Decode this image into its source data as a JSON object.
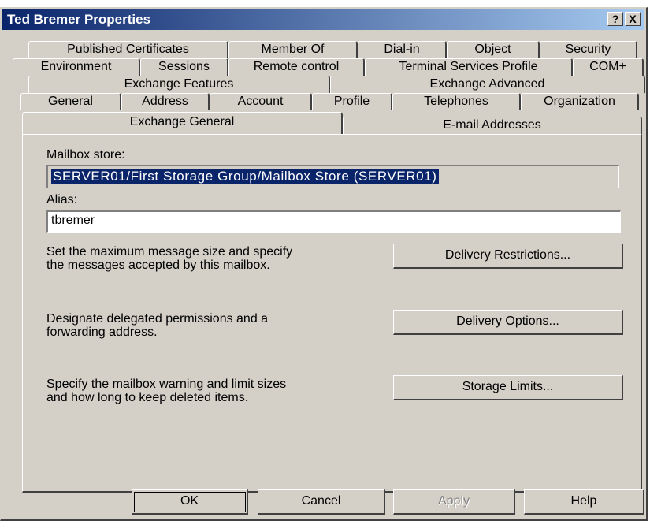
{
  "window": {
    "title": "Ted Bremer Properties",
    "help_glyph": "?",
    "close_glyph": "X"
  },
  "tabs": {
    "row1": [
      "Published Certificates",
      "Member Of",
      "Dial-in",
      "Object",
      "Security"
    ],
    "row2": [
      "Environment",
      "Sessions",
      "Remote control",
      "Terminal Services Profile",
      "COM+"
    ],
    "row3": [
      "Exchange Features",
      "Exchange Advanced"
    ],
    "row4": [
      "General",
      "Address",
      "Account",
      "Profile",
      "Telephones",
      "Organization"
    ],
    "row5": [
      "Exchange General",
      "E-mail Addresses"
    ],
    "active": "Exchange General"
  },
  "form": {
    "mailbox_store_label": "Mailbox store:",
    "mailbox_store_value": "SERVER01/First Storage Group/Mailbox Store (SERVER01)",
    "alias_label": "Alias:",
    "alias_value": "tbremer"
  },
  "sections": [
    {
      "desc_line1": "Set the maximum message size and specify",
      "desc_line2": "the messages accepted by this mailbox.",
      "button": "Delivery Restrictions..."
    },
    {
      "desc_line1": "Designate delegated permissions and a",
      "desc_line2": "forwarding address.",
      "button": "Delivery Options..."
    },
    {
      "desc_line1": "Specify the mailbox warning and limit sizes",
      "desc_line2": "and how long to keep deleted items.",
      "button": "Storage Limits..."
    }
  ],
  "footer": {
    "ok": "OK",
    "cancel": "Cancel",
    "apply": "Apply",
    "help": "Help"
  }
}
